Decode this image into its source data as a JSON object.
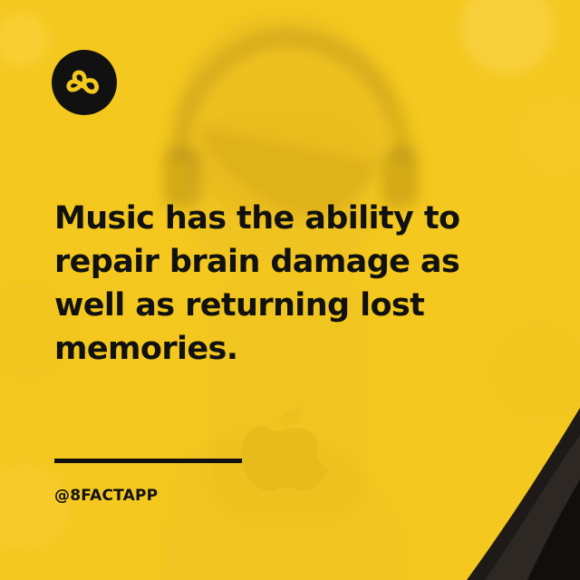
{
  "brand": {
    "logo_icon": "infinity-eight-icon",
    "primary_color": "#f4c81f",
    "text_color": "#111111"
  },
  "post": {
    "headline": "Music has the ability to repair brain damage as well as returning lost memories.",
    "handle": "@8FACTAPP"
  }
}
